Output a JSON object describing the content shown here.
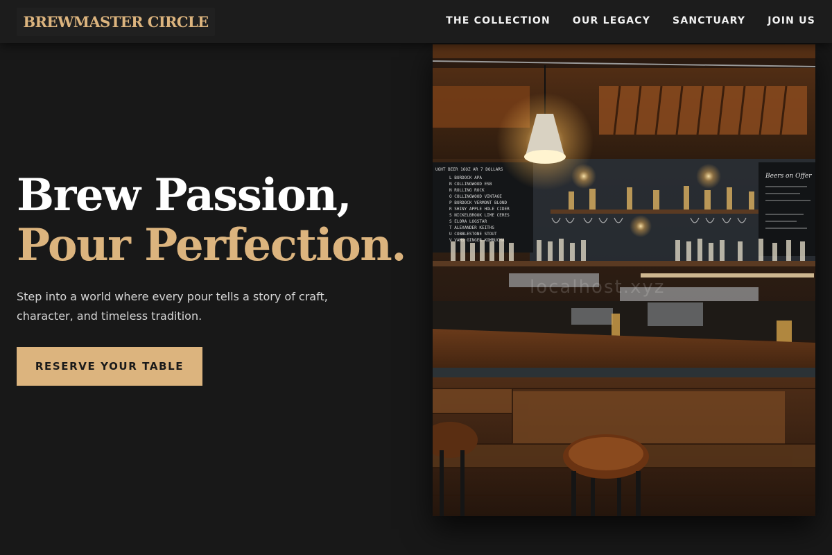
{
  "brand": {
    "name": "BREWMASTER CIRCLE"
  },
  "nav": {
    "links": [
      "THE COLLECTION",
      "OUR LEGACY",
      "SANCTUARY",
      "JOIN US"
    ]
  },
  "hero": {
    "headline_line1": "Brew Passion,",
    "headline_line2": "Pour Perfection.",
    "lead": "Step into a world where every pour tells a story of craft, character, and timeless tradition.",
    "cta_label": "RESERVE YOUR TABLE"
  },
  "image": {
    "subject": "Dimly lit craft beer bar with pendant lamp, chalkboard menus, bottle shelves, wooden bar counter and stools",
    "chalkboard_left_header": "UGHT BEER    16OZ  AR 7 DOLLARS",
    "chalkboard_left_items": [
      "L BURDOCK APA",
      "N COLLINGWOOD ESB",
      "N ROLLING ROCK",
      "O COLLINGWOOD VINTAGE",
      "P BURDOCK VERMONT BLOND",
      "R SHINY APPLE HOLE CIDER",
      "S NICKELBROOK LIME CERES",
      "S ELORA LOGSTAR",
      "T ALEXANDER KEITHS",
      "U COBBLESTONE STOUT",
      "V VAMS GINGER KOMBUCHA"
    ],
    "chalkboard_right_header": "Beers on Offer",
    "watermark": "localhost.xyz"
  },
  "colors": {
    "background": "#181818",
    "accent": "#dcb47e",
    "text": "#f2f2f2"
  }
}
